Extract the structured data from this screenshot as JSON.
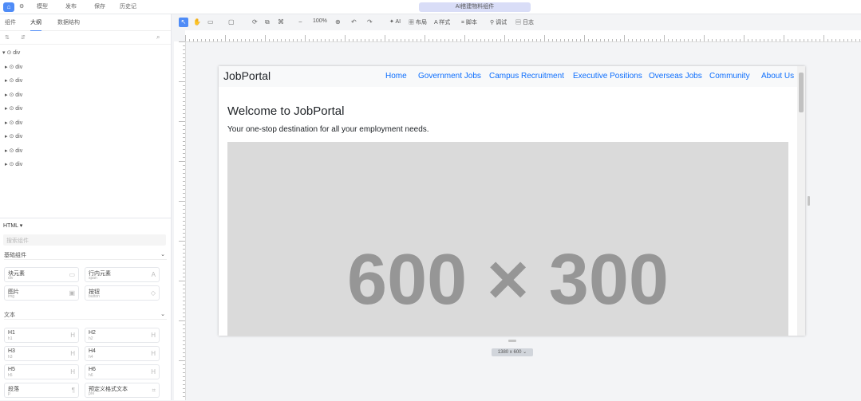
{
  "topbar": {
    "home_icon": "home-icon",
    "items": [
      "模型",
      "发布",
      "保存",
      "历史记"
    ],
    "ai_label": "AI搭建物料组件"
  },
  "left_tabs": [
    "组件",
    "大纲",
    "数据结构"
  ],
  "tree": {
    "root": "div",
    "children": [
      "div",
      "div",
      "div",
      "div",
      "div",
      "div",
      "div",
      "div"
    ]
  },
  "html_panel": {
    "title": "HTML",
    "search_placeholder": "搜索组件",
    "sections": [
      {
        "label": "基础组件",
        "items": [
          {
            "title": "块元素",
            "sub": "div"
          },
          {
            "title": "行内元素",
            "sub": "span"
          },
          {
            "title": "图片",
            "sub": "img"
          },
          {
            "title": "按钮",
            "sub": "button"
          }
        ]
      },
      {
        "label": "文本",
        "items": [
          {
            "title": "H1",
            "sub": "h1"
          },
          {
            "title": "H2",
            "sub": "h2"
          },
          {
            "title": "H3",
            "sub": "h3"
          },
          {
            "title": "H4",
            "sub": "h4"
          },
          {
            "title": "H5",
            "sub": "h5"
          },
          {
            "title": "H6",
            "sub": "h6"
          },
          {
            "title": "段落",
            "sub": "p"
          },
          {
            "title": "预定义格式文本",
            "sub": "pre"
          }
        ]
      }
    ]
  },
  "toolbar": {
    "zoom": "100%",
    "items": [
      "AI",
      "布局",
      "样式",
      "脚本",
      "调试",
      "日志"
    ]
  },
  "preview": {
    "brand": "JobPortal",
    "nav": [
      "Home",
      "Government Jobs",
      "Campus Recruitment",
      "Executive Positions",
      "Overseas Jobs",
      "Community",
      "About Us"
    ],
    "heading": "Welcome to JobPortal",
    "subheading": "Your one-stop destination for all your employment needs.",
    "placeholder": "600 × 300"
  },
  "canvas_size": "1380 x 600"
}
